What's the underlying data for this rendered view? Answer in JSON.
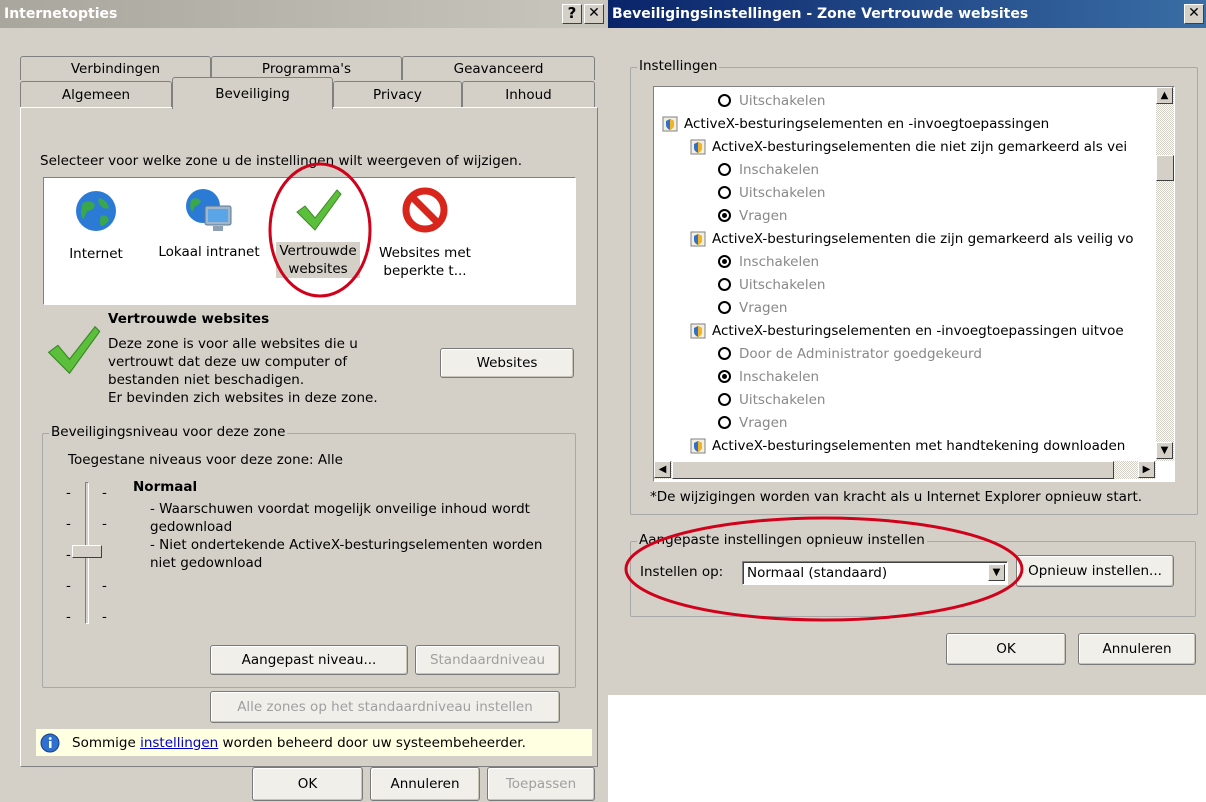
{
  "left": {
    "title": "Internetopties",
    "help_btn": "?",
    "close_btn": "✕",
    "tabs_back": [
      "Verbindingen",
      "Programma's",
      "Geavanceerd"
    ],
    "tabs_front": [
      "Algemeen",
      "Beveiliging",
      "Privacy",
      "Inhoud"
    ],
    "zone_prompt": "Selecteer voor welke zone u de instellingen wilt weergeven of wijzigen.",
    "zones": [
      {
        "line1": "Internet",
        "line2": ""
      },
      {
        "line1": "Lokaal intranet",
        "line2": ""
      },
      {
        "line1": "Vertrouwde",
        "line2": "websites"
      },
      {
        "line1": "Websites met",
        "line2": "beperkte t..."
      }
    ],
    "zone_heading": "Vertrouwde websites",
    "zone_desc": [
      "Deze zone is voor alle websites die u",
      "vertrouwt dat deze uw computer of",
      "bestanden niet beschadigen.",
      "Er bevinden zich websites in deze zone."
    ],
    "websites_btn": "Websites",
    "level_group": "Beveiligingsniveau voor deze zone",
    "allowed_levels": "Toegestane niveaus voor deze zone: Alle",
    "level_name": "Normaal",
    "level_points": [
      "- Waarschuwen voordat mogelijk onveilige inhoud wordt",
      "gedownload",
      "- Niet ondertekende ActiveX-besturingselementen worden",
      "niet gedownload"
    ],
    "slider_level": 3,
    "custom_level_btn": "Aangepast niveau...",
    "default_level_btn": "Standaardniveau",
    "all_zones_btn": "Alle zones op het standaardniveau instellen",
    "notice_pre": "Sommige ",
    "notice_link": "instellingen",
    "notice_post": " worden beheerd door uw systeembeheerder.",
    "ok_btn": "OK",
    "cancel_btn": "Annuleren",
    "apply_btn": "Toepassen"
  },
  "right": {
    "title": "Beveiligingsinstellingen - Zone Vertrouwde websites",
    "close_btn": "✕",
    "settings_group": "Instellingen",
    "tree": [
      {
        "type": "radio",
        "indent": 2,
        "checked": false,
        "text": "Uitschakelen"
      },
      {
        "type": "node",
        "indent": 0,
        "text": "ActiveX-besturingselementen en -invoegtoepassingen"
      },
      {
        "type": "node",
        "indent": 1,
        "text": "ActiveX-besturingselementen die niet zijn gemarkeerd als vei"
      },
      {
        "type": "radio",
        "indent": 2,
        "checked": false,
        "text": "Inschakelen"
      },
      {
        "type": "radio",
        "indent": 2,
        "checked": false,
        "text": "Uitschakelen"
      },
      {
        "type": "radio",
        "indent": 2,
        "checked": true,
        "text": "Vragen"
      },
      {
        "type": "node",
        "indent": 1,
        "text": "ActiveX-besturingselementen die zijn gemarkeerd als veilig vo"
      },
      {
        "type": "radio",
        "indent": 2,
        "checked": true,
        "text": "Inschakelen"
      },
      {
        "type": "radio",
        "indent": 2,
        "checked": false,
        "text": "Uitschakelen"
      },
      {
        "type": "radio",
        "indent": 2,
        "checked": false,
        "text": "Vragen"
      },
      {
        "type": "node",
        "indent": 1,
        "text": "ActiveX-besturingselementen en -invoegtoepassingen uitvoe"
      },
      {
        "type": "radio",
        "indent": 2,
        "checked": false,
        "text": "Door de Administrator goedgekeurd"
      },
      {
        "type": "radio",
        "indent": 2,
        "checked": true,
        "text": "Inschakelen"
      },
      {
        "type": "radio",
        "indent": 2,
        "checked": false,
        "text": "Uitschakelen"
      },
      {
        "type": "radio",
        "indent": 2,
        "checked": false,
        "text": "Vragen"
      },
      {
        "type": "node",
        "indent": 1,
        "text": "ActiveX-besturingselementen met handtekening downloaden"
      }
    ],
    "restart_note": "*De wijzigingen worden van kracht als u Internet Explorer opnieuw start.",
    "reset_group": "Aangepaste instellingen opnieuw instellen",
    "reset_label": "Instellen op:",
    "reset_value": "Normaal (standaard)",
    "reset_btn": "Opnieuw instellen...",
    "ok_btn": "OK",
    "cancel_btn": "Annuleren"
  },
  "colors": {
    "titlebar_inactive": "#b4b2a8",
    "titlebar_active": "#0a246a",
    "dialog_bg": "#d4d0c8",
    "highlight_ring": "#d0021b",
    "notice_bg": "#ffffe1",
    "link": "#0000cc"
  }
}
